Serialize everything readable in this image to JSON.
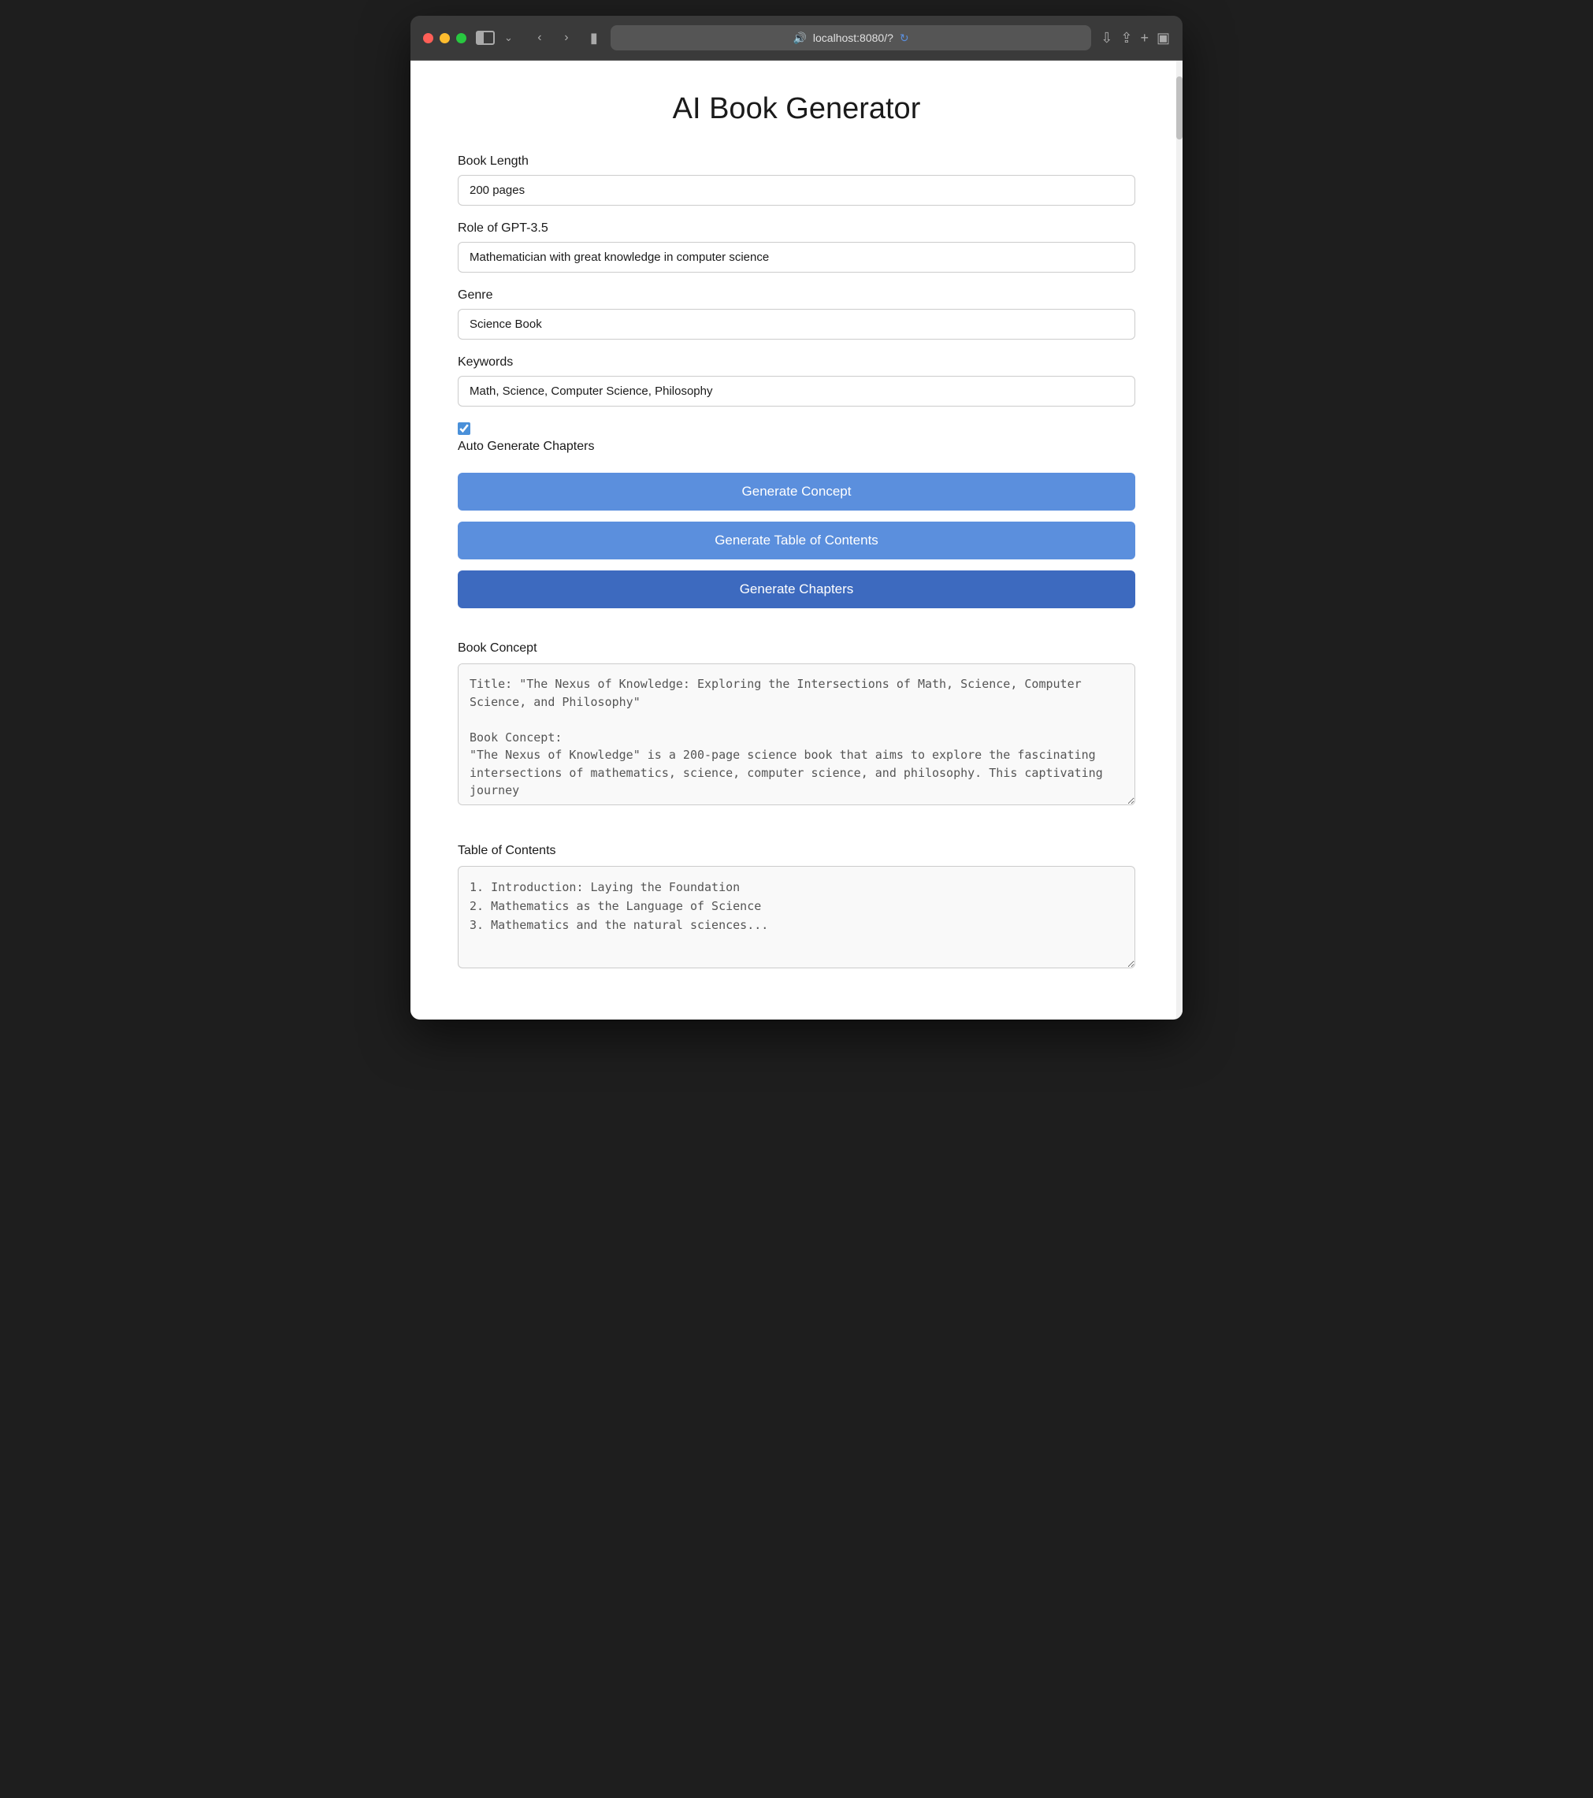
{
  "browser": {
    "url": "localhost:8080/?",
    "traffic_lights": [
      "red",
      "yellow",
      "green"
    ]
  },
  "page": {
    "title": "AI Book Generator",
    "fields": {
      "book_length": {
        "label": "Book Length",
        "value": "200 pages"
      },
      "role": {
        "label": "Role of GPT-3.5",
        "value": "Mathematician with great knowledge in computer science"
      },
      "genre": {
        "label": "Genre",
        "value": "Science Book"
      },
      "keywords": {
        "label": "Keywords",
        "value": "Math, Science, Computer Science, Philosophy"
      },
      "auto_generate": {
        "label": "Auto Generate Chapters",
        "checked": true
      }
    },
    "buttons": {
      "generate_concept": "Generate Concept",
      "generate_toc": "Generate Table of Contents",
      "generate_chapters": "Generate Chapters"
    },
    "book_concept": {
      "label": "Book Concept",
      "value": "Title: \"The Nexus of Knowledge: Exploring the Intersections of Math, Science, Computer Science, and Philosophy\"\n\nBook Concept:\n\"The Nexus of Knowledge\" is a 200-page science book that aims to explore the fascinating intersections of mathematics, science, computer science, and philosophy. This captivating journey"
    },
    "toc": {
      "label": "Table of Contents",
      "value": "1. Introduction: Laying the Foundation\n2. Mathematics as the Language of Science\n3. Mathematics and the natural sciences..."
    }
  }
}
